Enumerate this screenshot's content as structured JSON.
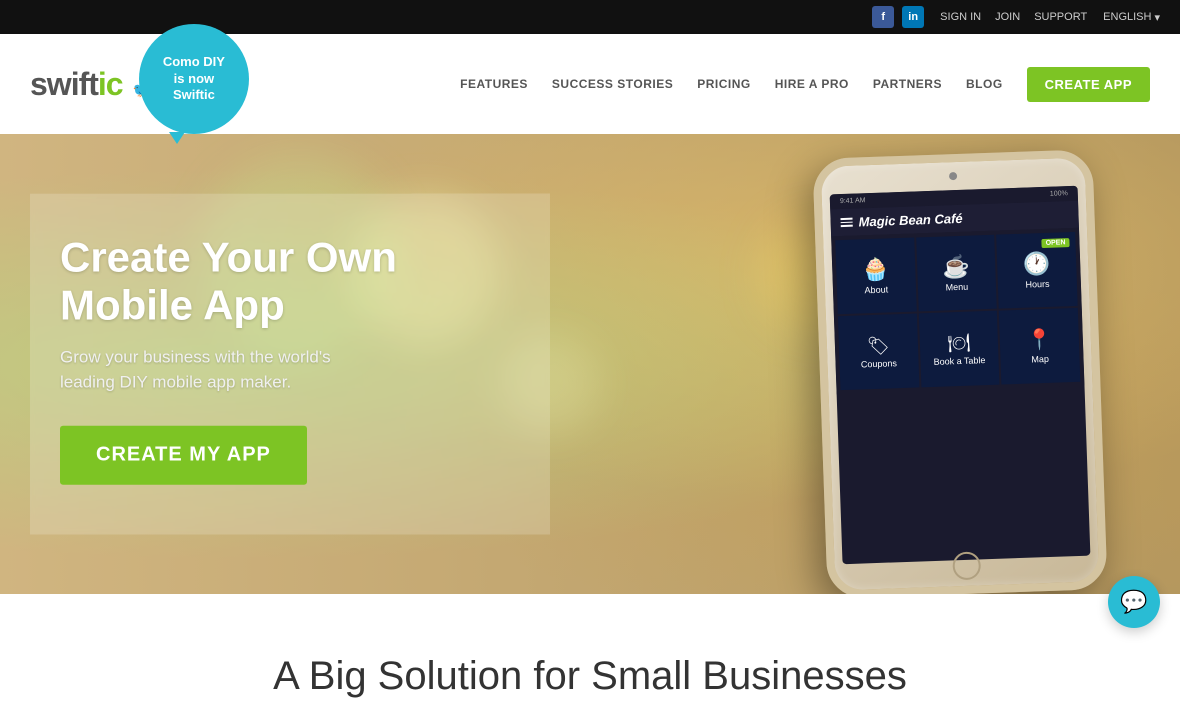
{
  "topbar": {
    "facebook_label": "f",
    "linkedin_label": "in",
    "signin_label": "SIGN IN",
    "join_label": "JOIN",
    "support_label": "SUPPORT",
    "language_label": "ENGLISH",
    "lang_arrow": "▾"
  },
  "header": {
    "logo_swift": "swiftic",
    "bubble_line1": "Como DIY",
    "bubble_line2": "is now",
    "bubble_line3": "Swiftic",
    "nav": {
      "features": "FEATURES",
      "success_stories": "SUCCESS STORIES",
      "pricing": "PRICING",
      "hire_a_pro": "HIRE A PRO",
      "partners": "PARTNERS",
      "blog": "BLOG",
      "create_app": "CREATE APP"
    }
  },
  "hero": {
    "title": "Create Your Own Mobile App",
    "subtitle_line1": "Grow your business with the world's",
    "subtitle_line2": "leading DIY mobile app maker.",
    "cta": "CREATE MY APP"
  },
  "phone": {
    "status_left": "9:41 AM",
    "status_right": "100%",
    "app_title": "Magic Bean Café",
    "grid_items": [
      {
        "icon": "🧁",
        "label": "About"
      },
      {
        "icon": "☕",
        "label": "Menu"
      },
      {
        "icon": "🕐",
        "label": "Hours",
        "badge": "OPEN"
      },
      {
        "icon": "🏷",
        "label": "Coupons"
      },
      {
        "icon": "🍽",
        "label": "Book a Table"
      },
      {
        "icon": "📍",
        "label": "Map"
      }
    ]
  },
  "bottom": {
    "title": "A Big Solution for Small Businesses"
  },
  "chat": {
    "icon": "💬"
  }
}
